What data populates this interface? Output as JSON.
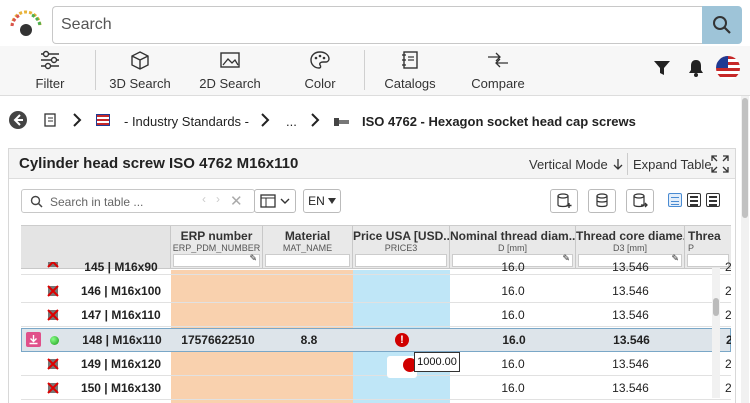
{
  "search": {
    "placeholder": "Search"
  },
  "toolbar": {
    "filter": "Filter",
    "search3d": "3D Search",
    "search2d": "2D Search",
    "color": "Color",
    "catalogs": "Catalogs",
    "compare": "Compare"
  },
  "breadcrumb": {
    "level1": "- Industry Standards -",
    "level2": "...",
    "level3": "ISO 4762 - Hexagon socket head cap screws"
  },
  "panel": {
    "title": "Cylinder head screw ISO 4762 M16x110",
    "vertical_mode": "Vertical Mode",
    "expand_table": "Expand Table",
    "table_search_placeholder": "Search in table ...",
    "language": "EN"
  },
  "columns": [
    {
      "title": "ERP number",
      "sub": "ERP_PDM_NUMBER"
    },
    {
      "title": "Material",
      "sub": "MAT_NAME"
    },
    {
      "title": "Price USA [USD...",
      "sub": "PRICE3"
    },
    {
      "title": "Nominal thread diam...",
      "sub": "D [mm]"
    },
    {
      "title": "Thread core diame...",
      "sub": "D3 [mm]"
    },
    {
      "title": "Threa",
      "sub": "P"
    }
  ],
  "rows": [
    {
      "id": "145 | M16x90",
      "erp": "",
      "mat": "",
      "d": "16.0",
      "d3": "13.546",
      "p": "2",
      "selected": false
    },
    {
      "id": "146 | M16x100",
      "erp": "",
      "mat": "",
      "d": "16.0",
      "d3": "13.546",
      "p": "2",
      "selected": false
    },
    {
      "id": "147 | M16x110",
      "erp": "",
      "mat": "",
      "d": "16.0",
      "d3": "13.546",
      "p": "2",
      "selected": false
    },
    {
      "id": "148 | M16x110",
      "erp": "17576622510",
      "mat": "8.8",
      "d": "16.0",
      "d3": "13.546",
      "p": "2",
      "selected": true
    },
    {
      "id": "149 | M16x120",
      "erp": "",
      "mat": "",
      "d": "16.0",
      "d3": "13.546",
      "p": "2",
      "selected": false
    },
    {
      "id": "150 | M16x130",
      "erp": "",
      "mat": "",
      "d": "16.0",
      "d3": "13.546",
      "p": "2",
      "selected": false
    }
  ],
  "tooltip": "1000.00",
  "colors": {
    "erp_bg": "#f9d1ae",
    "price_bg": "#bfe6f7",
    "selected_bg": "#dde4ea",
    "accent": "#9ec4d8",
    "error": "#d00000"
  }
}
